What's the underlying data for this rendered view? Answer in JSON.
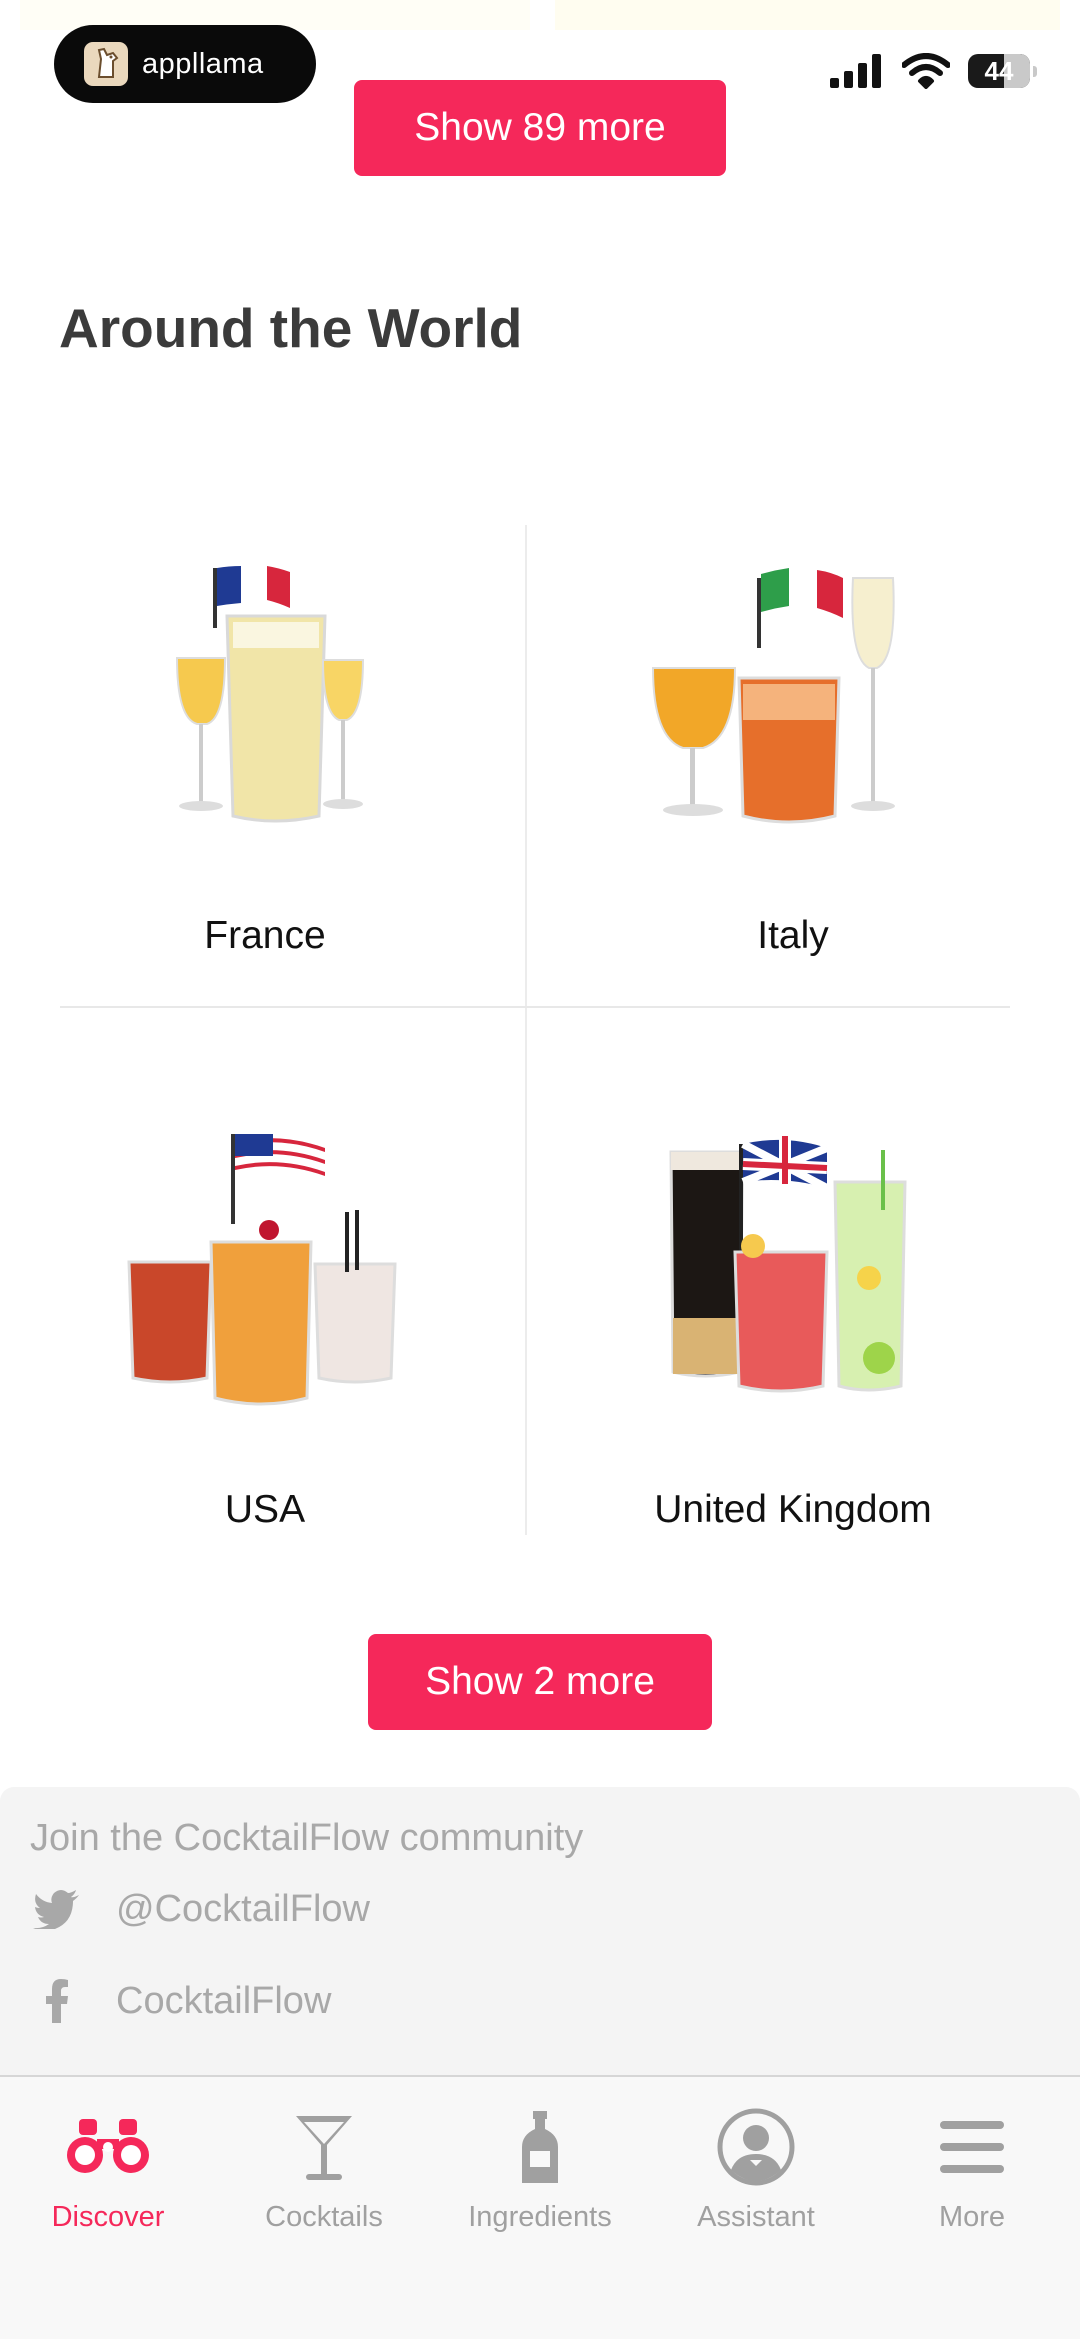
{
  "status_bar": {
    "app_pill_label": "appllama",
    "battery_level": "44"
  },
  "prev_section": {
    "show_more_label": "Show 89 more"
  },
  "around_world": {
    "title": "Around the World",
    "items": [
      {
        "label": "France",
        "icon": "france-cocktails"
      },
      {
        "label": "Italy",
        "icon": "italy-cocktails"
      },
      {
        "label": "USA",
        "icon": "usa-cocktails"
      },
      {
        "label": "United Kingdom",
        "icon": "uk-cocktails"
      }
    ],
    "show_more_label": "Show 2 more"
  },
  "community": {
    "heading": "Join the CocktailFlow community",
    "twitter": "@CocktailFlow",
    "facebook": "CocktailFlow"
  },
  "tabbar": {
    "tabs": [
      {
        "label": "Discover",
        "icon": "binoculars-icon",
        "active": true
      },
      {
        "label": "Cocktails",
        "icon": "cocktail-glass-icon",
        "active": false
      },
      {
        "label": "Ingredients",
        "icon": "bottle-icon",
        "active": false
      },
      {
        "label": "Assistant",
        "icon": "bartender-icon",
        "active": false
      },
      {
        "label": "More",
        "icon": "menu-icon",
        "active": false
      }
    ]
  },
  "colors": {
    "accent": "#f5285a",
    "muted": "#a0a0a0",
    "community_bg": "#f4f4f4"
  }
}
